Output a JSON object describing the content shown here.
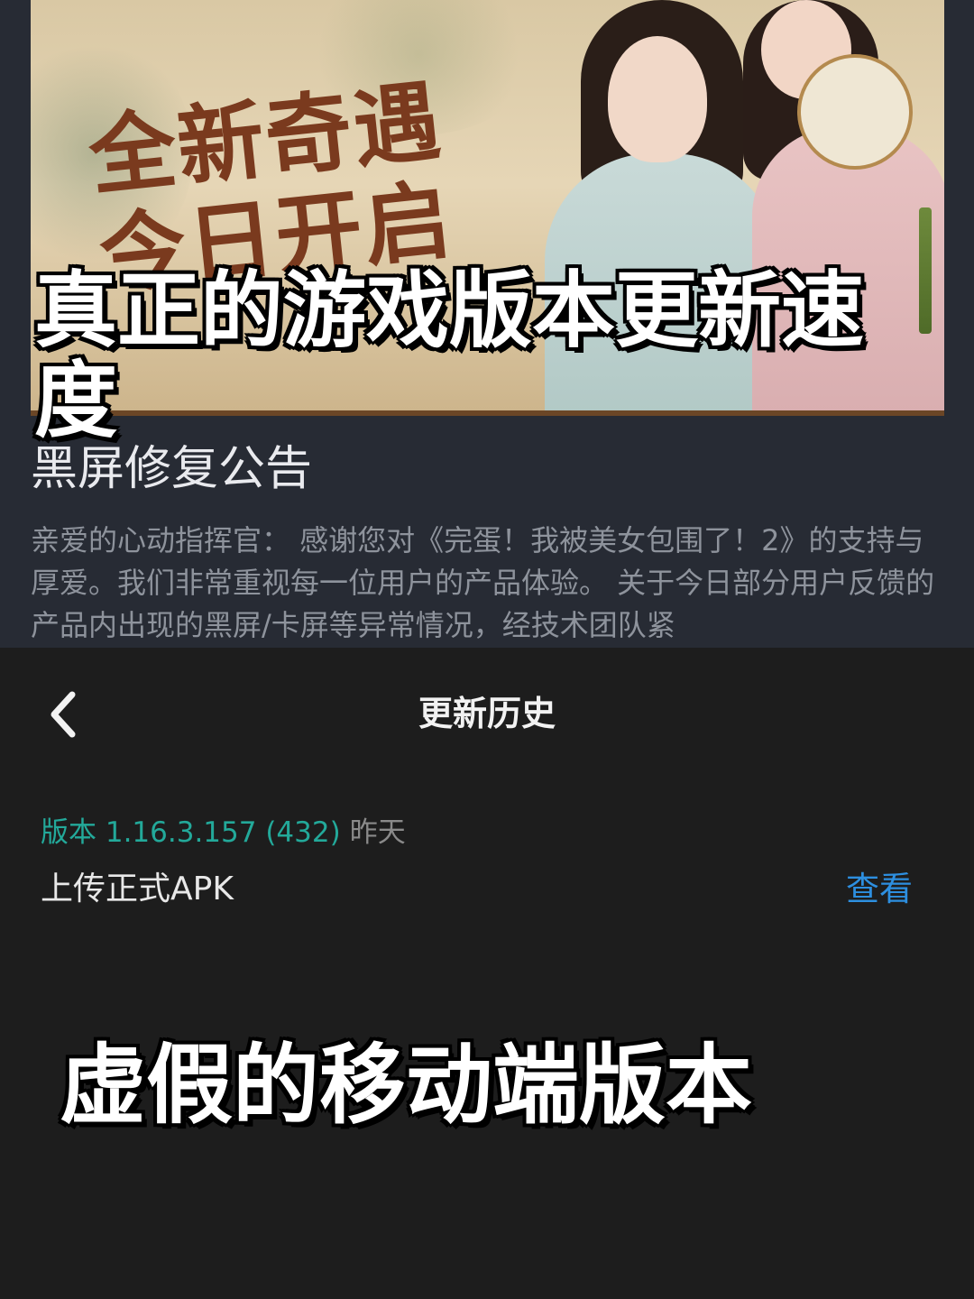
{
  "banner": {
    "headline": "全新奇遇今日开启"
  },
  "overlay_top": "真正的游戏版本更新速度",
  "announcement": {
    "title": "黑屏修复公告",
    "body": "亲爱的心动指挥官： 感谢您对《完蛋！我被美女包围了！2》的支持与厚爱。我们非常重视每一位用户的产品体验。 关于今日部分用户反馈的产品内出现的黑屏/卡屏等异常情况，经技术团队紧"
  },
  "update_history": {
    "nav_title": "更新历史",
    "back_icon": "chevron-left-icon",
    "entry": {
      "version_label": "版本 1.16.3.157 (432)",
      "date": "昨天",
      "description": "上传正式APK",
      "view_label": "查看"
    }
  },
  "overlay_bottom": "虚假的移动端版本",
  "colors": {
    "version_accent": "#23a99a",
    "link_blue": "#2d8fe0",
    "banner_text": "#7a3a1e"
  }
}
